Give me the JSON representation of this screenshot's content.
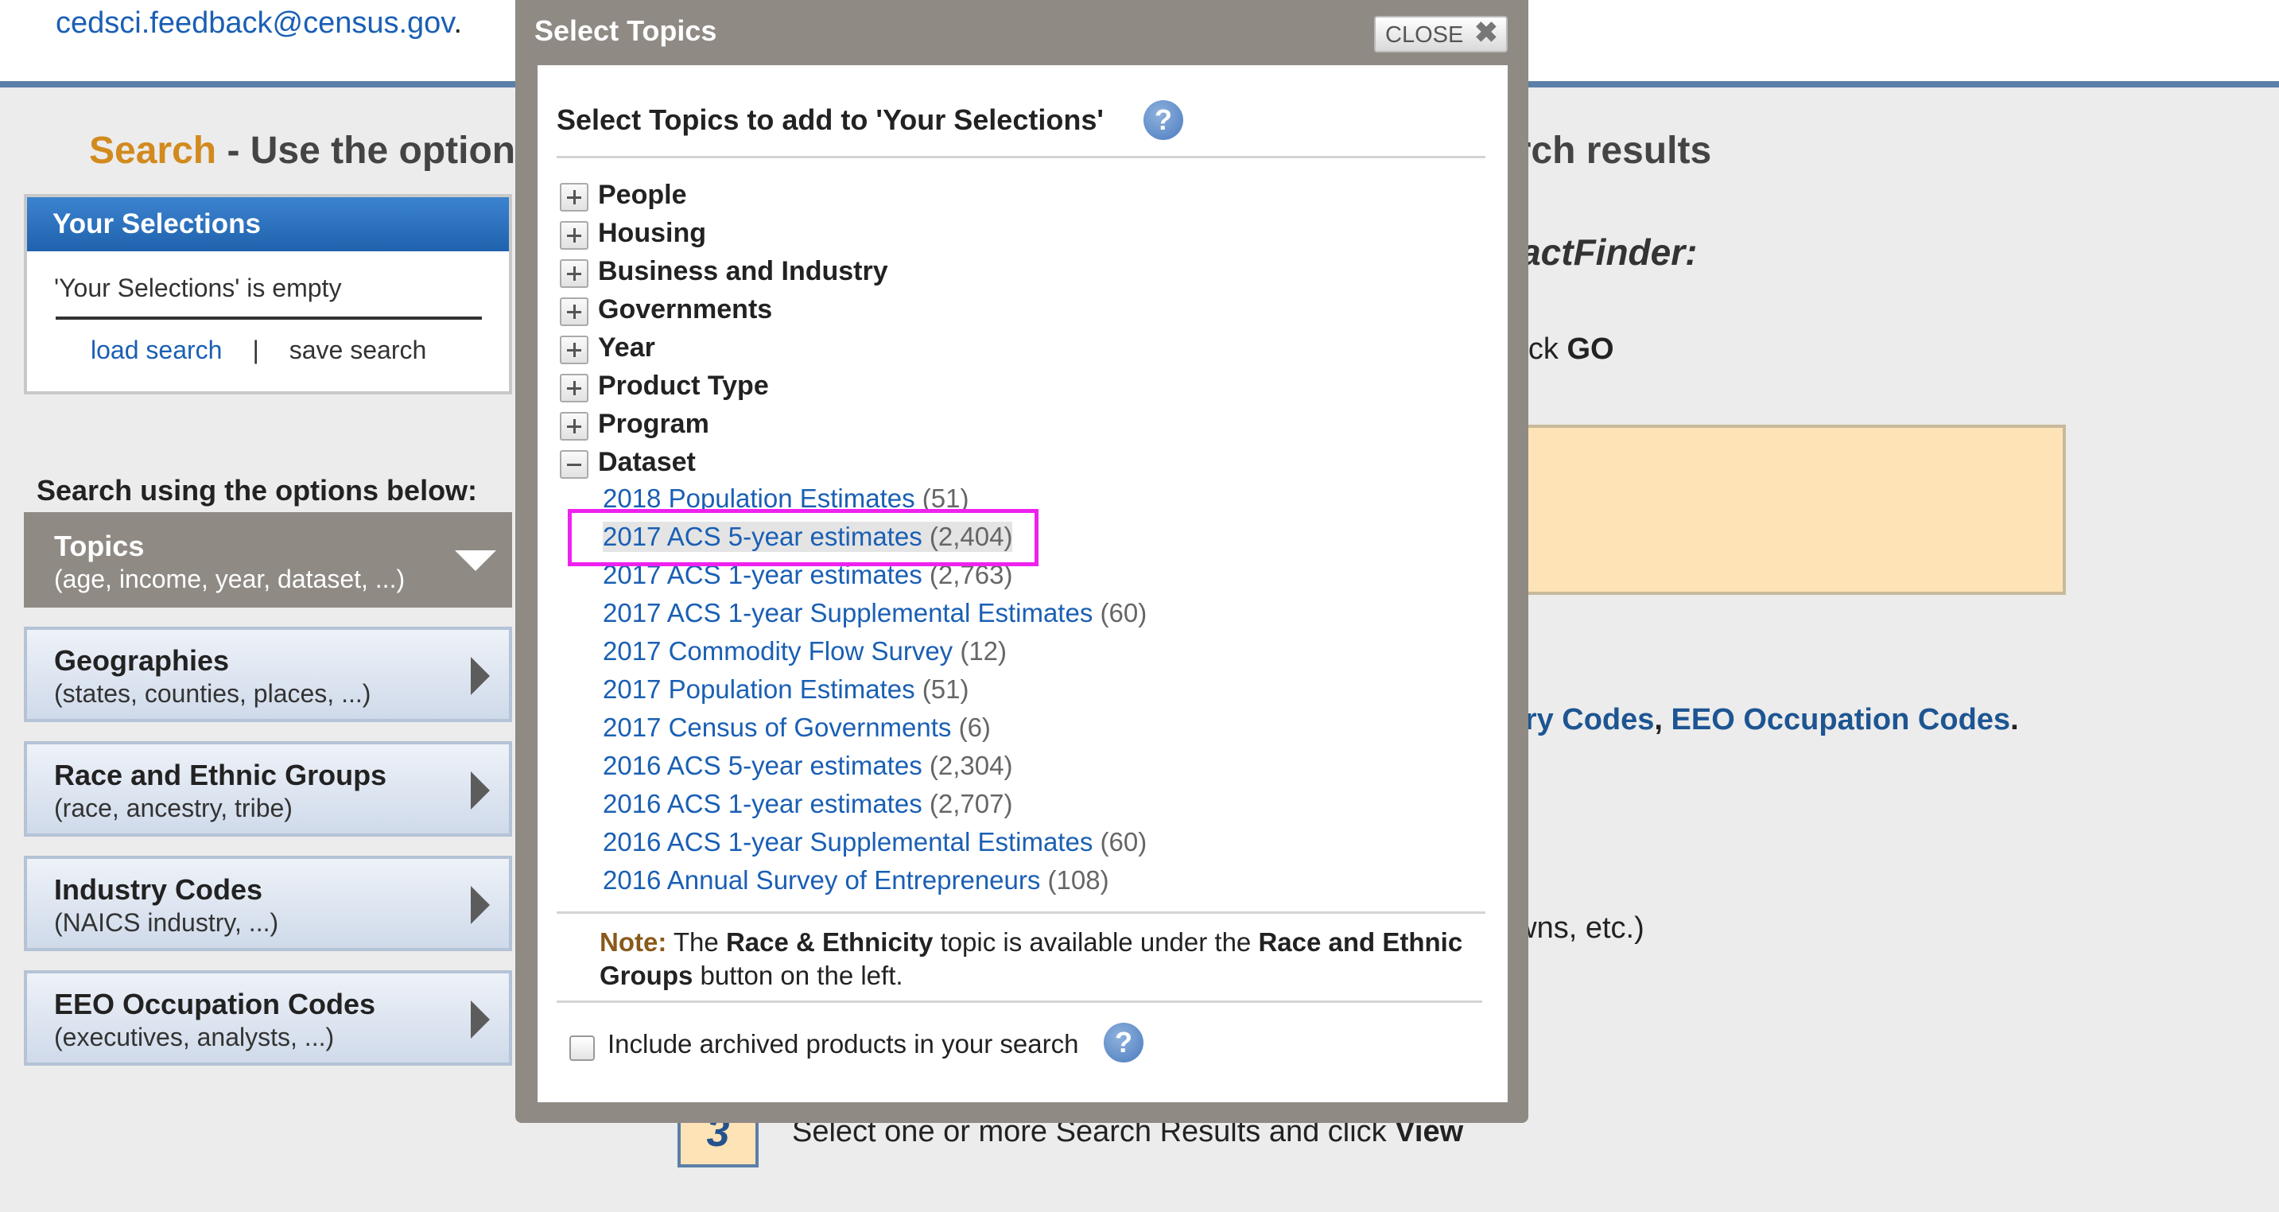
{
  "header": {
    "email_link": "cedsci.feedback@census.gov",
    "email_suffix": "."
  },
  "page": {
    "heading_accent": "Search",
    "heading_rest": " - Use the options",
    "heading_right": "arch results"
  },
  "selections": {
    "title": "Your Selections",
    "empty_text": "'Your Selections' is empty",
    "load_label": "load search",
    "separator": "|",
    "save_label": "save search"
  },
  "search_options_label": "Search using the options below:",
  "nav": [
    {
      "title": "Topics",
      "sub": "(age, income, year, dataset, ...)"
    },
    {
      "title": "Geographies",
      "sub": "(states, counties, places, ...)"
    },
    {
      "title": "Race and Ethnic Groups",
      "sub": "(race, ancestry, tribe)"
    },
    {
      "title": "Industry Codes",
      "sub": "(NAICS industry, ...)"
    },
    {
      "title": "EEO Occupation Codes",
      "sub": "(executives, analysts, ...)"
    }
  ],
  "background": {
    "factfinder": "FactFinder:",
    "click_go_prefix": "click ",
    "click_go_bold": "GO",
    "codes_part1": "stry Codes",
    "codes_comma": ", ",
    "codes_part2": "EEO Occupation Codes",
    "codes_period": ".",
    "towns_text": "owns, etc.)",
    "step3_number": "3",
    "step3_prefix": "Select one or more Search Results and click ",
    "step3_bold": "View"
  },
  "modal": {
    "title": "Select Topics",
    "close_label": "CLOSE",
    "close_symbol": "✖",
    "heading": "Select Topics to add to 'Your Selections'",
    "help_symbol": "?",
    "topics": [
      {
        "label": "People",
        "state": "collapsed"
      },
      {
        "label": "Housing",
        "state": "collapsed"
      },
      {
        "label": "Business and Industry",
        "state": "collapsed"
      },
      {
        "label": "Governments",
        "state": "collapsed"
      },
      {
        "label": "Year",
        "state": "collapsed"
      },
      {
        "label": "Product Type",
        "state": "collapsed"
      },
      {
        "label": "Program",
        "state": "collapsed"
      },
      {
        "label": "Dataset",
        "state": "expanded"
      }
    ],
    "datasets": [
      {
        "name": "2018 Population Estimates",
        "count": "(51)"
      },
      {
        "name": "2017 ACS 5-year estimates",
        "count": "(2,404)",
        "selected": true
      },
      {
        "name": "2017 ACS 1-year estimates",
        "count": "(2,763)"
      },
      {
        "name": "2017 ACS 1-year Supplemental Estimates",
        "count": "(60)"
      },
      {
        "name": "2017 Commodity Flow Survey",
        "count": "(12)"
      },
      {
        "name": "2017 Population Estimates",
        "count": "(51)"
      },
      {
        "name": "2017 Census of Governments",
        "count": "(6)"
      },
      {
        "name": "2016 ACS 5-year estimates",
        "count": "(2,304)"
      },
      {
        "name": "2016 ACS 1-year estimates",
        "count": "(2,707)"
      },
      {
        "name": "2016 ACS 1-year Supplemental Estimates",
        "count": "(60)"
      },
      {
        "name": "2016 Annual Survey of Entrepreneurs",
        "count": "(108)"
      }
    ],
    "note": {
      "label": "Note:",
      "t1": " The ",
      "b1": "Race & Ethnicity",
      "t2": " topic is available under the ",
      "b2": "Race and Ethnic Groups",
      "t3": " button on the left."
    },
    "archive_label": "Include archived products in your search",
    "archive_checked": false
  },
  "colors": {
    "accent_orange": "#d28a1e",
    "link_blue": "#1a5fb4",
    "modal_frame": "#8f8a84",
    "highlight_magenta": "#ee22ee",
    "selections_header": "#2f74c0",
    "note_label": "#8a5a1c"
  }
}
